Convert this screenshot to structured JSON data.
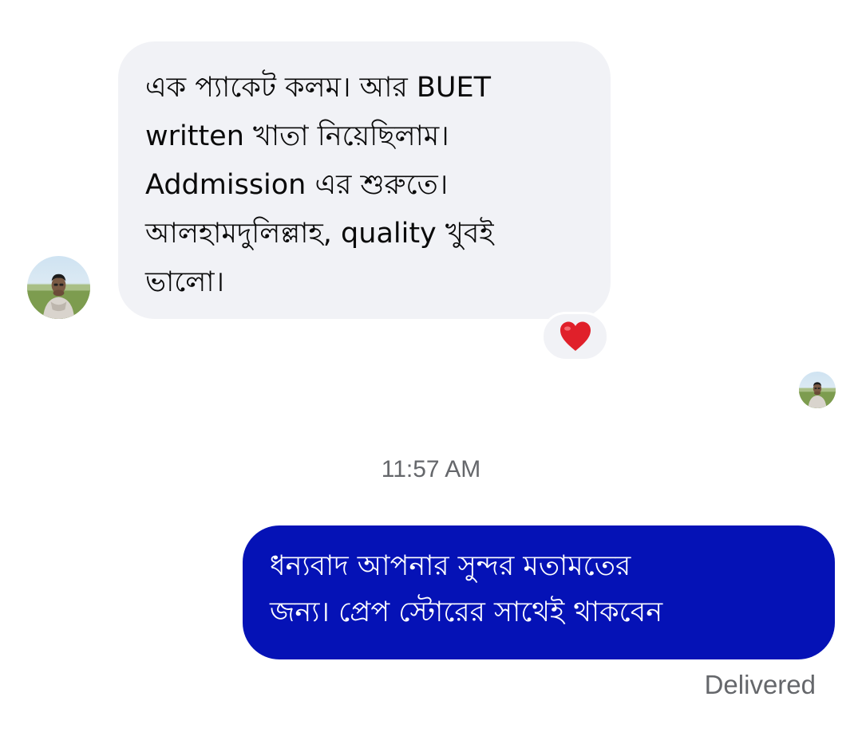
{
  "conversation": {
    "incoming": {
      "text": "এক প্যাকেট কলম। আর BUET\nwritten খাতা নিয়েছিলাম।\nAddmission এর শুরুতে।\nআলহামদুলিল্লাহ, quality খুবই\nভালো।",
      "reaction_icon": "red-heart"
    },
    "timestamp": "11:57 AM",
    "outgoing": {
      "text": "ধন্যবাদ আপনার সুন্দর মতামতের\nজন্য। প্রেপ স্টোরের সাথেই থাকবেন",
      "status": "Delivered"
    }
  },
  "colors": {
    "incoming_bubble": "#f1f2f6",
    "outgoing_bubble": "#0512b6",
    "meta_text": "#65676b",
    "heart": "#e0202a"
  }
}
